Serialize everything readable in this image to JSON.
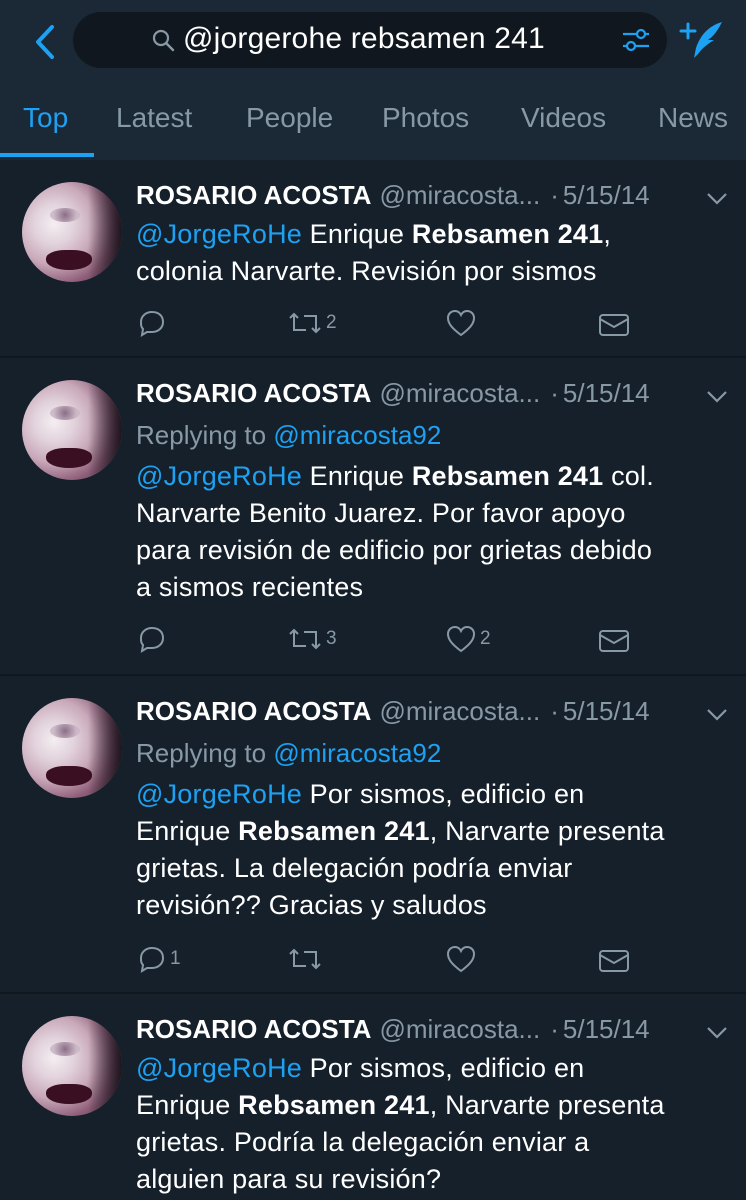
{
  "search": {
    "query": "@jorgerohe rebsamen 241"
  },
  "tabs": [
    {
      "label": "Top",
      "active": true
    },
    {
      "label": "Latest"
    },
    {
      "label": "People"
    },
    {
      "label": "Photos"
    },
    {
      "label": "Videos"
    },
    {
      "label": "News"
    }
  ],
  "tweets": [
    {
      "name": "ROSARIO ACOSTA",
      "handle": "@miracosta...",
      "dot": "·",
      "date": "5/15/14",
      "replying_prefix": "",
      "replying_to": "",
      "mention": "@JorgeRoHe",
      "segments": [
        " Enrique ",
        "Rebsamen 241",
        ",",
        "colonia Narvarte. Revisión por sismos"
      ],
      "counts": {
        "reply": "",
        "retweet": "2",
        "like": ""
      }
    },
    {
      "name": "ROSARIO ACOSTA",
      "handle": "@miracosta...",
      "dot": "·",
      "date": "5/15/14",
      "replying_prefix": "Replying to",
      "replying_to": "@miracosta92",
      "mention": "@JorgeRoHe",
      "segments": [
        " Enrique ",
        "Rebsamen 241",
        " col.",
        "Narvarte Benito Juarez. Por favor apoyo",
        "para revisión de edificio por grietas debido",
        "a sismos recientes"
      ],
      "counts": {
        "reply": "",
        "retweet": "3",
        "like": "2"
      }
    },
    {
      "name": "ROSARIO ACOSTA",
      "handle": "@miracosta...",
      "dot": "·",
      "date": "5/15/14",
      "replying_prefix": "Replying to",
      "replying_to": "@miracosta92",
      "mention": "@JorgeRoHe",
      "segments": [
        " Por sismos, edificio en",
        "Enrique ",
        "Rebsamen 241",
        ", Narvarte presenta",
        "grietas. La delegación podría enviar",
        "revisión?? Gracias y saludos"
      ],
      "counts": {
        "reply": "1",
        "retweet": "",
        "like": ""
      }
    },
    {
      "name": "ROSARIO ACOSTA",
      "handle": "@miracosta...",
      "dot": "·",
      "date": "5/15/14",
      "replying_prefix": "",
      "replying_to": "",
      "mention": "@JorgeRoHe",
      "segments": [
        " Por sismos, edificio en",
        "Enrique ",
        "Rebsamen 241",
        ", Narvarte presenta",
        "grietas. Podría la delegación enviar a",
        "alguien para su revisión?"
      ],
      "counts": {
        "reply": "",
        "retweet": "",
        "like": ""
      }
    }
  ],
  "colors": {
    "background": "#15202b",
    "accent": "#1da1f2",
    "muted": "#8899a6"
  },
  "icons": [
    "back-arrow-icon",
    "search-icon",
    "filter-icon",
    "compose-tweet-icon",
    "reply-icon",
    "retweet-icon",
    "like-icon",
    "dm-icon",
    "chevron-down-icon"
  ]
}
